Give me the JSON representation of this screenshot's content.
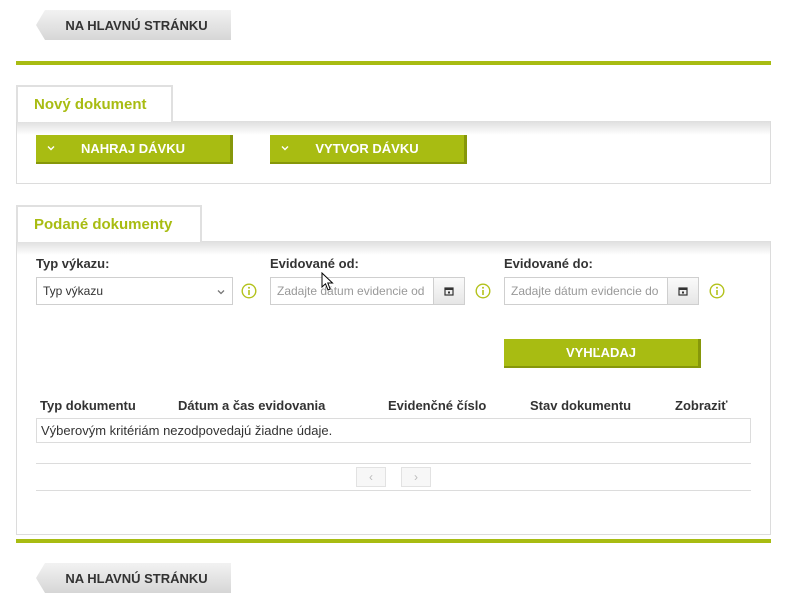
{
  "nav": {
    "home_label": "NA HLAVNÚ STRÁNKU"
  },
  "new_document": {
    "tab_label": "Nový dokument",
    "upload_label": "NAHRAJ DÁVKU",
    "create_label": "VYTVOR DÁVKU"
  },
  "submitted_documents": {
    "tab_label": "Podané dokumenty",
    "filters": {
      "report_type": {
        "label": "Typ výkazu:",
        "selected": "Typ výkazu"
      },
      "date_from": {
        "label": "Evidované od:",
        "placeholder": "Zadajte dátum evidencie od"
      },
      "date_to": {
        "label": "Evidované do:",
        "placeholder": "Zadajte dátum evidencie do"
      }
    },
    "search_label": "VYHĽADAJ",
    "table": {
      "columns": [
        "Typ dokumentu",
        "Dátum a čas evidovania",
        "Evidenčné číslo",
        "Stav dokumentu",
        "Zobraziť"
      ],
      "empty_message": "Výberovým kritériám nezodpovedajú žiadne údaje."
    },
    "pager": {
      "prev": "‹",
      "next": "›"
    }
  },
  "colors": {
    "accent": "#a8bc12",
    "accent_dark": "#86970a",
    "info": "#b3c21c"
  },
  "icons": [
    "chevron-down-icon",
    "calendar-icon",
    "info-icon",
    "mouse-cursor-icon"
  ]
}
